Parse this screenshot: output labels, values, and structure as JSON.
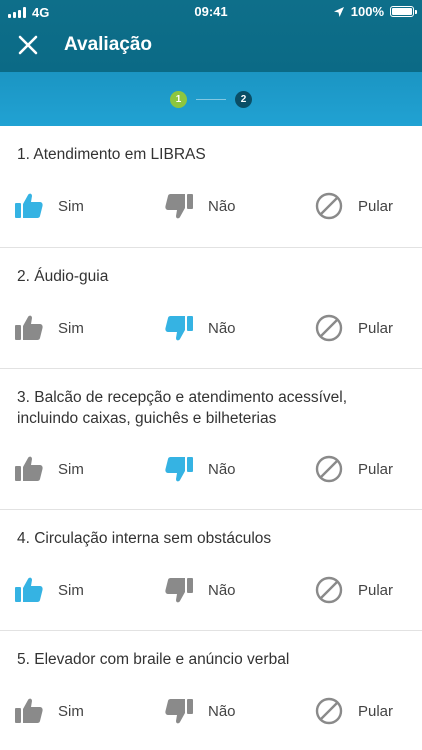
{
  "status_bar": {
    "carrier": "4G",
    "time": "09:41",
    "battery": "100%"
  },
  "header": {
    "title": "Avaliação"
  },
  "stepper": {
    "steps": [
      "1",
      "2"
    ],
    "current_step": 1
  },
  "colors": {
    "selected": "#35b3e3",
    "unselected": "#8a8a8a",
    "header": "#0b6a86",
    "step_active": "#8dc63f"
  },
  "options": {
    "yes": "Sim",
    "no": "Não",
    "skip": "Pular"
  },
  "questions": [
    {
      "text": "1. Atendimento em LIBRAS",
      "answer": "yes"
    },
    {
      "text": "2. Áudio-guia",
      "answer": "no"
    },
    {
      "text": "3. Balcão de recepção e atendimento acessível, incluindo caixas, guichês e bilheterias",
      "answer": "no"
    },
    {
      "text": "4. Circulação interna sem obstáculos",
      "answer": "yes"
    },
    {
      "text": "5. Elevador com braile e anúncio verbal",
      "answer": "none"
    }
  ]
}
